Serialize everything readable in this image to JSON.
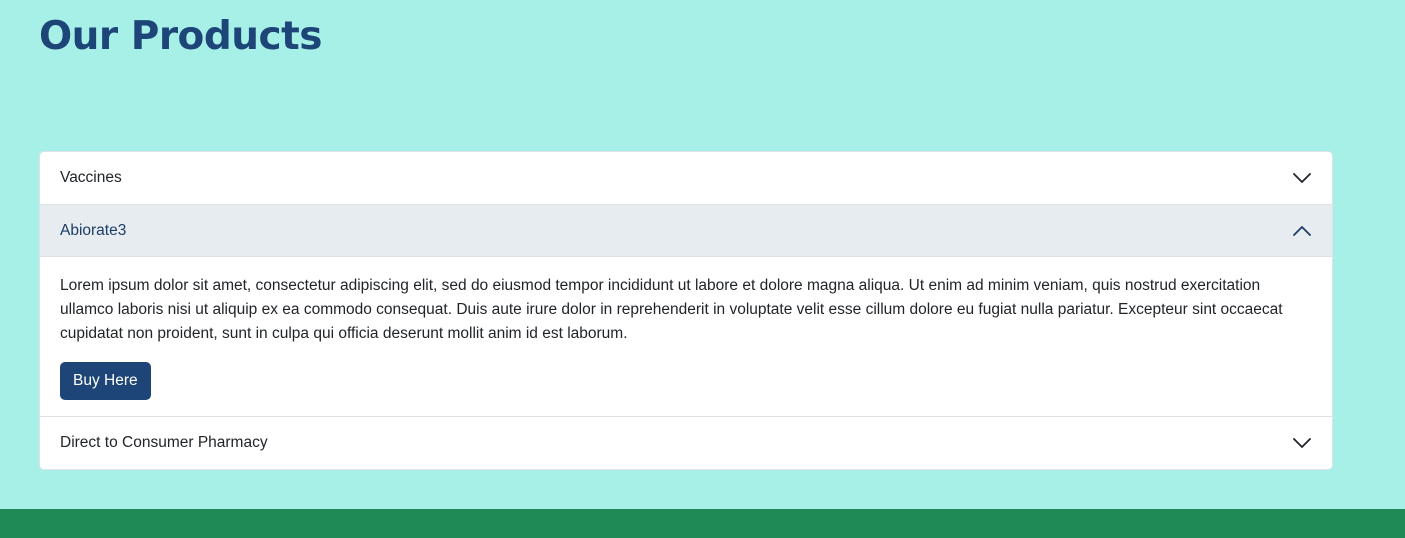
{
  "page": {
    "title": "Our Products"
  },
  "accordion": {
    "items": [
      {
        "label": "Vaccines",
        "expanded": false,
        "icon": "chevron-down-icon"
      },
      {
        "label": "Abiorate3",
        "expanded": true,
        "icon": "chevron-up-icon",
        "body": "Lorem ipsum dolor sit amet, consectetur adipiscing elit, sed do eiusmod tempor incididunt ut labore et dolore magna aliqua. Ut enim ad minim veniam, quis nostrud exercitation ullamco laboris nisi ut aliquip ex ea commodo consequat. Duis aute irure dolor in reprehenderit in voluptate velit esse cillum dolore eu fugiat nulla pariatur. Excepteur sint occaecat cupidatat non proident, sunt in culpa qui officia deserunt mollit anim id est laborum.",
        "button_label": "Buy Here"
      },
      {
        "label": "Direct to Consumer Pharmacy",
        "expanded": false,
        "icon": "chevron-down-icon"
      }
    ]
  },
  "colors": {
    "background": "#a6f0e8",
    "title": "#1d4577",
    "button": "#1d4577",
    "active_header": "#e7ecf1",
    "footer": "#1f8a55"
  }
}
